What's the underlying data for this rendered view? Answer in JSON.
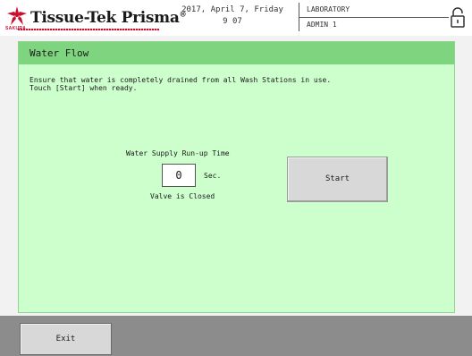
{
  "header": {
    "brand": "Tissue-Tek Prisma",
    "brand_mark": "®",
    "sakura": "SAKURA",
    "date": "2017, April 7, Friday",
    "time": "9 07",
    "lab": "LABORATORY",
    "user": "ADMIN 1",
    "logo_icon": "sakura-flower-icon",
    "lock_icon": "lock-icon",
    "brand_color": "#c8102e"
  },
  "panel": {
    "title": "Water Flow",
    "instructions": [
      "Ensure that water is completely drained from all Wash Stations in use.",
      "Touch [Start] when ready."
    ],
    "supply_label": "Water Supply Run-up Time",
    "time_value": "0",
    "time_unit": "Sec.",
    "valve_status": "Valve is Closed",
    "start_label": "Start",
    "header_color": "#7fd47f",
    "background_color": "#ccffcc"
  },
  "footer": {
    "exit_label": "Exit"
  }
}
